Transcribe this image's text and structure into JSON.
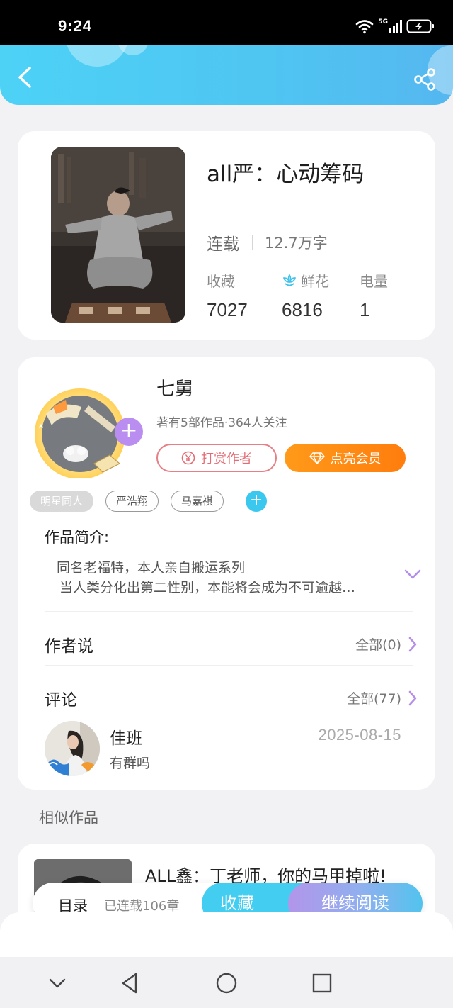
{
  "status_bar": {
    "time": "9:24",
    "network": "5G"
  },
  "book": {
    "title": "all严：心动筹码",
    "serial_status": "连载",
    "word_count": "12.7万字",
    "stats": [
      {
        "label": "收藏",
        "value": "7027",
        "icon": ""
      },
      {
        "label": "鲜花",
        "value": "6816",
        "icon": "flower-icon"
      },
      {
        "label": "电量",
        "value": "1",
        "icon": ""
      }
    ]
  },
  "author": {
    "name": "七舅",
    "meta": "著有5部作品·364人关注",
    "tip_label": "打赏作者",
    "vip_label": "点亮会员"
  },
  "tags": [
    "明星同人",
    "严浩翔",
    "马嘉祺"
  ],
  "intro": {
    "heading": "作品简介:",
    "line1": "同名老福特，本人亲自搬运系列",
    "line2": "当人类分化出第二性别，本能将会成为不可逾越…"
  },
  "author_says": {
    "title": "作者说",
    "link": "全部(0)"
  },
  "comments": {
    "title": "评论",
    "link": "全部(77)",
    "items": [
      {
        "user": "佳班",
        "date": "2025-08-15",
        "text": "有群吗"
      }
    ]
  },
  "similar": {
    "heading": "相似作品",
    "items": [
      {
        "title": "ALL鑫：丁老师，你的马甲掉啦!"
      }
    ]
  },
  "actions": {
    "toc": "目录",
    "chapters": "已连载106章",
    "favorite": "收藏",
    "continue": "继续阅读"
  },
  "colors": {
    "header": "#4fc5f2",
    "accent_purple": "#b98ef0",
    "vip_orange": "#ff8c14",
    "tip_red": "#e46b74"
  }
}
